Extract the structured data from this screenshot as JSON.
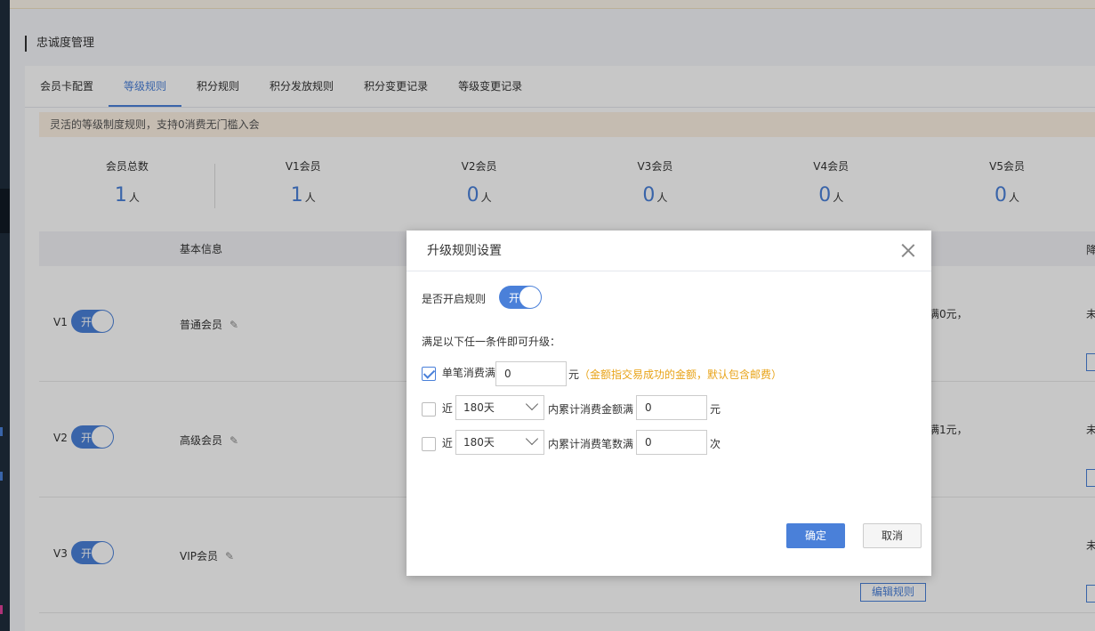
{
  "page": {
    "title": "忠诚度管理"
  },
  "tabs": [
    "会员卡配置",
    "等级规则",
    "积分规则",
    "积分发放规则",
    "积分变更记录",
    "等级变更记录"
  ],
  "notice": "灵活的等级制度规则，支持0消费无门槛入会",
  "stats": [
    {
      "label": "会员总数",
      "value": "1",
      "unit": "人"
    },
    {
      "label": "V1会员",
      "value": "1",
      "unit": "人"
    },
    {
      "label": "V2会员",
      "value": "0",
      "unit": "人"
    },
    {
      "label": "V3会员",
      "value": "0",
      "unit": "人"
    },
    {
      "label": "V4会员",
      "value": "0",
      "unit": "人"
    },
    {
      "label": "V5会员",
      "value": "0",
      "unit": "人"
    }
  ],
  "table": {
    "header_basic": "基本信息",
    "header_right": "降",
    "rows": [
      {
        "level": "V1",
        "toggle": "开",
        "name": "普通会员",
        "right_text": "满0元，",
        "far": "未"
      },
      {
        "level": "V2",
        "toggle": "开",
        "name": "高级会员",
        "right_text": "满1元，",
        "far": "未"
      },
      {
        "level": "V3",
        "toggle": "开",
        "name": "VIP会员",
        "right_text": "",
        "far": "未",
        "edit": "编辑规则"
      }
    ]
  },
  "modal": {
    "title": "升级规则设置",
    "enable_label": "是否开启规则",
    "toggle_text": "开",
    "condition_label": "满足以下任一条件即可升级：",
    "rule1": {
      "prefix": "单笔消费满",
      "value": "0",
      "unit": "元",
      "hint": "（金额指交易成功的金额，默认包含邮费）",
      "checked": true
    },
    "rule2": {
      "prefix": "近",
      "period": "180天",
      "middle": "内累计消费金额满",
      "value": "0",
      "unit": "元",
      "checked": false
    },
    "rule3": {
      "prefix": "近",
      "period": "180天",
      "middle": "内累计消费笔数满",
      "value": "0",
      "unit": "次",
      "checked": false
    },
    "ok": "确定",
    "cancel": "取消"
  }
}
